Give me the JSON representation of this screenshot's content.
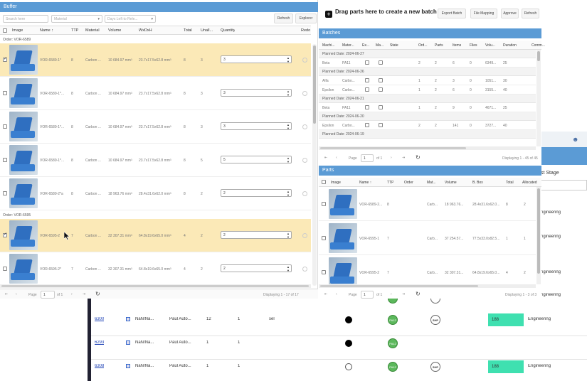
{
  "buffer": {
    "title": "Buffer",
    "search_placeholder": "Search here",
    "material_placeholder": "Material",
    "days_placeholder": "Days Left to Rele...",
    "refresh": "Refresh",
    "explorer": "Explorer",
    "columns": [
      "Image",
      "Name ↑",
      "TTP",
      "Material",
      "Volume",
      "WxDxH",
      "Total",
      "Unall...",
      "Quantity",
      "Redo"
    ],
    "groups": [
      {
        "label": "Order: VOR-6589",
        "rows": [
          {
            "name": "VOR-6589-1*",
            "ttp": "8",
            "material": "Carbon ...",
            "volume": "10 684.97 mm³",
            "dims": "23.7x17.5x62.8 mm³",
            "total": "8",
            "unall": "3",
            "qty": "3",
            "checked": true,
            "hl": true
          },
          {
            "name": "VOR-6589-1*...",
            "ttp": "8",
            "material": "Carbon ...",
            "volume": "10 684.97 mm³",
            "dims": "23.7x17.5x62.8 mm³",
            "total": "8",
            "unall": "3",
            "qty": "3",
            "checked": false,
            "hl": false
          },
          {
            "name": "VOR-6589-1*...",
            "ttp": "8",
            "material": "Carbon ...",
            "volume": "10 684.97 mm³",
            "dims": "23.7x17.5x62.8 mm³",
            "total": "8",
            "unall": "3",
            "qty": "3",
            "checked": false,
            "hl": false
          },
          {
            "name": "VOR-6589-1*...",
            "ttp": "8",
            "material": "Carbon ...",
            "volume": "10 684.97 mm³",
            "dims": "23.7x17.5x62.8 mm³",
            "total": "8",
            "unall": "5",
            "qty": "5",
            "checked": false,
            "hl": false
          },
          {
            "name": "VOR-6589-2*a",
            "ttp": "8",
            "material": "Carbon ...",
            "volume": "18 963.76 mm³",
            "dims": "28.4x31.6x62.0 mm³",
            "total": "8",
            "unall": "2",
            "qty": "2",
            "checked": false,
            "hl": false
          }
        ]
      },
      {
        "label": "Order: VOR-6595",
        "rows": [
          {
            "name": "VOR-6595-2",
            "ttp": "7",
            "material": "Carbon ...",
            "volume": "32 307.31 mm³",
            "dims": "64.8x19.6x65.0 mm³",
            "total": "4",
            "unall": "2",
            "qty": "2",
            "checked": true,
            "hl": true
          },
          {
            "name": "VOR-6595-2*",
            "ttp": "7",
            "material": "Carbon ...",
            "volume": "32 307.31 mm³",
            "dims": "64.8x19.6x65.0 mm³",
            "total": "4",
            "unall": "2",
            "qty": "2",
            "checked": false,
            "hl": false
          }
        ]
      }
    ],
    "pager": {
      "page_label": "Page",
      "page": "1",
      "of": "of 1",
      "display": "Displaying 1 - 17 of 17"
    }
  },
  "right": {
    "drag_text": "Drag parts here to create a new batch",
    "buttons": [
      "Export Batch",
      "File Mapping",
      "Approve",
      "Refresh"
    ]
  },
  "batches": {
    "title": "Batches",
    "columns": [
      "Machi...",
      "Mater...",
      "Ex...",
      "Ma...",
      "State",
      "Ord...",
      "Parts",
      "Items",
      "Files",
      "Volu...",
      "Duration",
      "Comm..."
    ],
    "rows": [
      {
        "type": "group",
        "label": "Planned Date: 2024-06-27"
      },
      {
        "type": "row",
        "cells": [
          "Beta",
          "PA11",
          "",
          "",
          "",
          "2",
          "2",
          "6",
          "0",
          "6349...",
          "25",
          ""
        ]
      },
      {
        "type": "group",
        "label": "Planned Date: 2024-06-26"
      },
      {
        "type": "row",
        "cells": [
          "Alfa",
          "Carbo...",
          "",
          "",
          "",
          "1",
          "2",
          "3",
          "0",
          "1051...",
          "30",
          ""
        ]
      },
      {
        "type": "row",
        "cells": [
          "Epsilon",
          "Carbo...",
          "",
          "",
          "",
          "1",
          "2",
          "6",
          "0",
          "3155...",
          "40",
          ""
        ]
      },
      {
        "type": "group",
        "label": "Planned Date: 2024-06-21"
      },
      {
        "type": "row",
        "cells": [
          "Beta",
          "PA11",
          "",
          "",
          "",
          "1",
          "2",
          "9",
          "0",
          "4671...",
          "25",
          ""
        ]
      },
      {
        "type": "group",
        "label": "Planned Date: 2024-06-20"
      },
      {
        "type": "row",
        "cells": [
          "Epsilon",
          "Carbo...",
          "",
          "",
          "",
          "2",
          "2",
          "141",
          "0",
          "3727...",
          "40",
          ""
        ]
      },
      {
        "type": "group",
        "label": "Planned Date: 2024-06-19"
      }
    ],
    "pager": {
      "page_label": "Page",
      "page": "1",
      "of": "of 1",
      "display": "Displaying 1 - 45 of 45"
    }
  },
  "parts": {
    "title": "Parts",
    "columns": [
      "Image",
      "Name ↑",
      "TTP",
      "Order",
      "Mat...",
      "Volume",
      "B. Box",
      "Total",
      "Allocated"
    ],
    "rows": [
      {
        "name": "VOR-6589-2...",
        "ttp": "8",
        "order": "",
        "mat": "Carb...",
        "volume": "18 963.76...",
        "bbox": "28.4x31.6x62.0...",
        "total": "8",
        "alloc": "2"
      },
      {
        "name": "VOR-6595-1",
        "ttp": "7",
        "order": "",
        "mat": "Carb...",
        "volume": "37 254.57...",
        "bbox": "77.5x33.0x82.5...",
        "total": "1",
        "alloc": "1"
      },
      {
        "name": "VOR-6595-2",
        "ttp": "7",
        "order": "",
        "mat": "Carb...",
        "volume": "32 307.31...",
        "bbox": "64.8x19.6x65.0...",
        "total": "4",
        "alloc": "2"
      }
    ],
    "pager": {
      "page_label": "Page",
      "page": "1",
      "of": "of 1",
      "display": "Displaying 1 - 3 of 3"
    }
  },
  "bg": {
    "stage_header": "st Stage",
    "engineering": "ngineering",
    "rows": [
      {
        "id": "6300",
        "nan": "NaN/Na...",
        "user": "Paul Auto...",
        "a": "12",
        "b": "1",
        "c": "sel",
        "dot": "black",
        "pa": "PA12",
        "shp": true,
        "value": "188",
        "dept": "Engineering"
      },
      {
        "id": "6293",
        "nan": "NaN/Na...",
        "user": "Paul Auto...",
        "a": "1",
        "b": "1",
        "c": "",
        "dot": "black",
        "pa": "PA12",
        "shp": false,
        "value": "",
        "dept": ""
      },
      {
        "id": "6308",
        "nan": "NaN/Na...",
        "user": "Paul Auto...",
        "a": "1",
        "b": "1",
        "c": "",
        "dot": "white",
        "pa": "PA12",
        "shp": true,
        "value": "188",
        "dept": "Engineering"
      }
    ]
  }
}
